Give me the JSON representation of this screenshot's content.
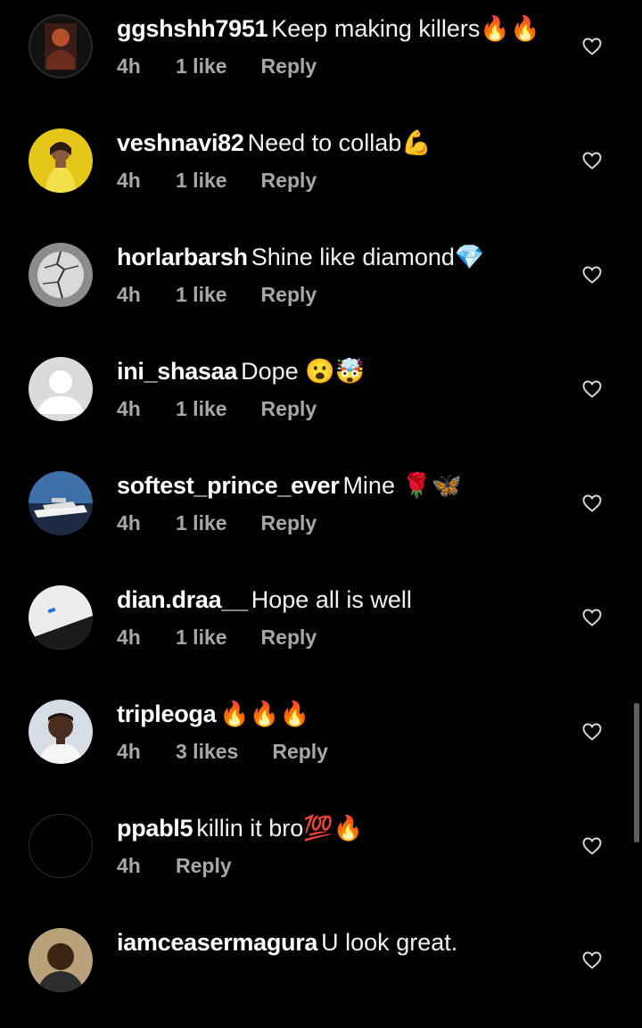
{
  "comments": [
    {
      "username": "ggshshh7951",
      "text": "Keep making killers🔥🔥",
      "time": "4h",
      "likes": "1 like",
      "reply": "Reply",
      "avatar": "dark-art"
    },
    {
      "username": "veshnavi82",
      "text": "Need to collab💪",
      "time": "4h",
      "likes": "1 like",
      "reply": "Reply",
      "avatar": "yellow-portrait"
    },
    {
      "username": "horlarbarsh",
      "text": "Shine like diamond💎",
      "time": "4h",
      "likes": "1 like",
      "reply": "Reply",
      "avatar": "cracked-grey"
    },
    {
      "username": "ini_shasaa",
      "text": "Dope 😮🤯",
      "time": "4h",
      "likes": "1 like",
      "reply": "Reply",
      "avatar": "default-silhouette"
    },
    {
      "username": "softest_prince_ever",
      "text": "Mine 🌹🦋",
      "time": "4h",
      "likes": "1 like",
      "reply": "Reply",
      "avatar": "yacht"
    },
    {
      "username": "dian.draa__",
      "text": "Hope all is well",
      "time": "4h",
      "likes": "1 like",
      "reply": "Reply",
      "avatar": "white-object"
    },
    {
      "username": "tripleoga",
      "text": "🔥🔥🔥",
      "time": "4h",
      "likes": "3 likes",
      "reply": "Reply",
      "avatar": "man-portrait"
    },
    {
      "username": "ppabl5",
      "text": "killin it bro💯🔥",
      "time": "4h",
      "likes": "",
      "reply": "Reply",
      "avatar": "black"
    },
    {
      "username": "iamceasermagura",
      "text": "U look great.",
      "time": "",
      "likes": "",
      "reply": "",
      "avatar": "man-portrait-2"
    }
  ],
  "icons": {
    "like": "heart-outline-icon"
  },
  "colors": {
    "background": "#000000",
    "username": "#ffffff",
    "meta": "#a8a8a8",
    "scrollbar": "#5f5f5f"
  }
}
